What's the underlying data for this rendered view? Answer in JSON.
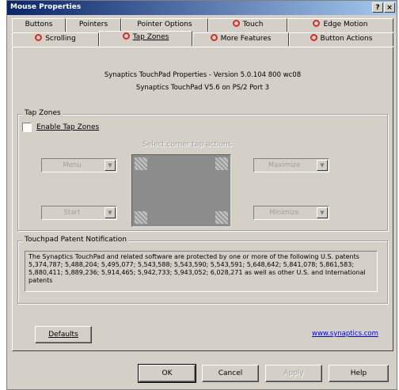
{
  "window": {
    "title": "Mouse Properties",
    "help_glyph": "?",
    "close_glyph": "×"
  },
  "tabs_row1": [
    "Buttons",
    "Pointers",
    "Pointer Options",
    "Touch",
    "Edge Motion"
  ],
  "tabs_row2": [
    "Scrolling",
    "Tap Zones",
    "More Features",
    "Button Actions"
  ],
  "active_tab": "Tap Zones",
  "header": {
    "line1": "Synaptics TouchPad Properties - Version 5.0.104 800 wc08",
    "line2": "Synaptics TouchPad V5.6 on PS/2 Port 3"
  },
  "tap_zones": {
    "group_label": "Tap Zones",
    "enable_label": "Enable Tap Zones",
    "enable_checked": false,
    "select_prompt": "Select corner tap actions",
    "top_left_value": "Menu",
    "top_right_value": "Maximize",
    "bottom_left_value": "Start",
    "bottom_right_value": "Minimize",
    "arrow_glyph": "▼"
  },
  "patent": {
    "group_label": "Touchpad Patent Notification",
    "text": "The Synaptics TouchPad and related software are protected by one or more of the following U.S. patents 5,374,787; 5,488,204; 5,495,077; 5,543,588; 5,543,590; 5,543,591; 5,648,642; 5,841,078; 5,861,583; 5,880,411; 5,889,236; 5,914,465; 5,942,733; 5,943,052; 6,028,271 as well as other U.S. and International patents"
  },
  "defaults_button": "Defaults",
  "link_text": "www.synaptics.com",
  "footer": {
    "ok": "OK",
    "cancel": "Cancel",
    "apply": "Apply",
    "help": "Help"
  }
}
